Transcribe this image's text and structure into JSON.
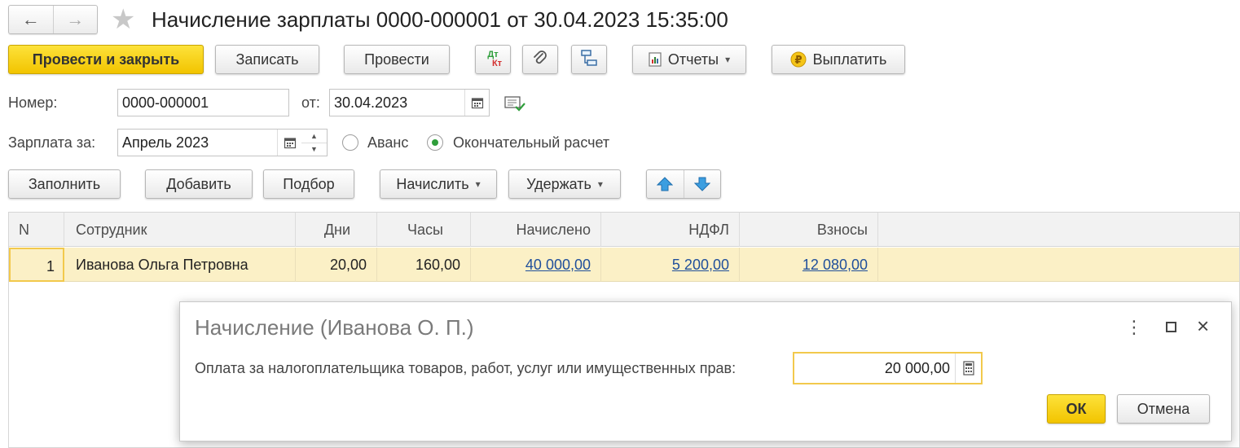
{
  "window": {
    "title": "Начисление зарплаты 0000-000001 от 30.04.2023 15:35:00"
  },
  "toolbar": {
    "post_and_close": "Провести и закрыть",
    "save": "Записать",
    "post": "Провести",
    "dtkt_top": "Дт",
    "dtkt_bottom": "Кт",
    "reports": "Отчеты",
    "pay": "Выплатить"
  },
  "form": {
    "number_label": "Номер:",
    "number_value": "0000-000001",
    "date_label": "от:",
    "date_value": "30.04.2023",
    "period_label": "Зарплата за:",
    "period_value": "Апрель 2023",
    "radio_advance": "Аванс",
    "radio_final": "Окончательный расчет",
    "selected_radio": "final"
  },
  "table_toolbar": {
    "fill": "Заполнить",
    "add": "Добавить",
    "pick": "Подбор",
    "accrue": "Начислить",
    "deduct": "Удержать"
  },
  "table": {
    "columns": [
      "N",
      "Сотрудник",
      "Дни",
      "Часы",
      "Начислено",
      "НДФЛ",
      "Взносы"
    ],
    "rows": [
      {
        "n": "1",
        "employee": "Иванова Ольга Петровна",
        "days": "20,00",
        "hours": "160,00",
        "accrued": "40 000,00",
        "ndfl": "5 200,00",
        "contributions": "12 080,00"
      }
    ]
  },
  "dialog": {
    "title": "Начисление (Иванова О. П.)",
    "field_label": "Оплата за налогоплательщика товаров, работ, услуг или имущественных прав:",
    "field_value": "20 000,00",
    "ok": "ОК",
    "cancel": "Отмена"
  },
  "colors": {
    "primary_button": "#f2c400",
    "selected_row": "#fbf0c6",
    "link": "#1f4f9b",
    "radio_dot": "#2f9e3b"
  }
}
